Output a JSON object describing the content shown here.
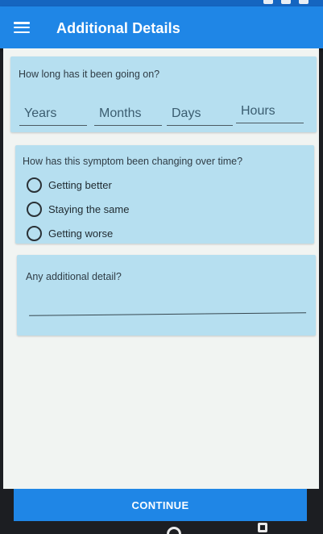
{
  "app_bar": {
    "title": "Additional Details",
    "menu_icon": "hamburger-menu-icon"
  },
  "duration_card": {
    "question": "How long has it been going on?",
    "fields": [
      {
        "placeholder": "Years"
      },
      {
        "placeholder": "Months"
      },
      {
        "placeholder": "Days"
      },
      {
        "placeholder": "Hours"
      }
    ]
  },
  "change_card": {
    "question": "How has this symptom been changing over time?",
    "options": [
      {
        "label": "Getting better",
        "selected": false
      },
      {
        "label": "Staying the same",
        "selected": false
      },
      {
        "label": "Getting worse",
        "selected": false
      }
    ]
  },
  "detail_card": {
    "question": "Any additional detail?",
    "value": ""
  },
  "footer": {
    "continue_label": "CONTINUE"
  },
  "colors": {
    "primary": "#1f86e6",
    "card_bg": "#b6dff0",
    "page_bg": "#f1f4f2"
  }
}
